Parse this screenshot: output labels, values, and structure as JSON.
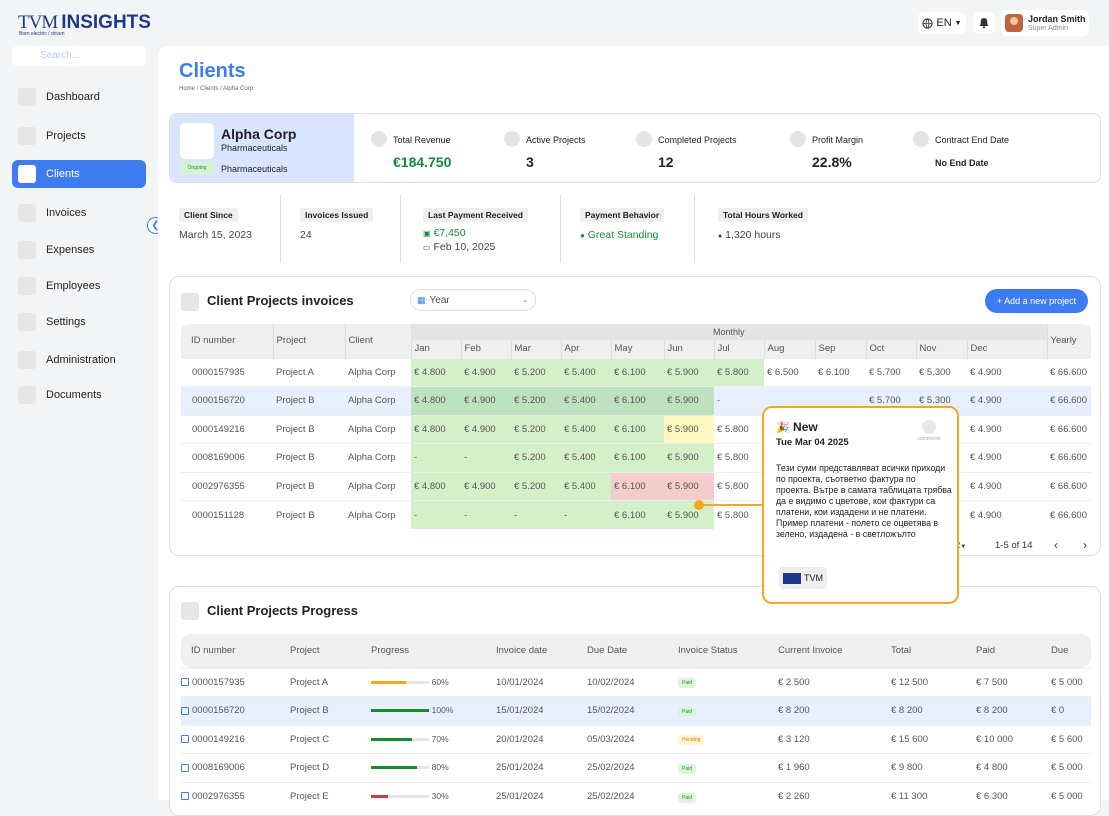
{
  "header": {
    "logo_tvm": "TVM",
    "logo_insights": "INSIGHTS",
    "logo_tagline": "Born electric / driven",
    "lang": "EN",
    "user_name": "Jordan Smith",
    "user_role": "Super Admin"
  },
  "sidebar": {
    "search_placeholder": "Search...",
    "items": [
      {
        "label": "Dashboard"
      },
      {
        "label": "Projects"
      },
      {
        "label": "Clients"
      },
      {
        "label": "Invoices"
      },
      {
        "label": "Expenses"
      },
      {
        "label": "Employees"
      },
      {
        "label": "Settings"
      },
      {
        "label": "Administration"
      },
      {
        "label": "Documents"
      }
    ],
    "active_index": 2
  },
  "page": {
    "title": "Clients",
    "breadcrumb": "Home / Clients / Alpha Corp"
  },
  "client": {
    "name": "Alpha Corp",
    "industry": "Pharmaceuticals",
    "industry2": "Pharmaceuticals",
    "status": "Ongoing",
    "stats": [
      {
        "label": "Total Revenue",
        "value": "€184.750"
      },
      {
        "label": "Active Projects",
        "value": "3"
      },
      {
        "label": "Completed Projects",
        "value": "12"
      },
      {
        "label": "Profit Margin",
        "value": "22.8%"
      },
      {
        "label": "Contract End Date",
        "value": "No End Date"
      }
    ]
  },
  "info": {
    "since_label": "Client Since",
    "since": "March 15, 2023",
    "invoices_label": "Invoices Issued",
    "invoices": "24",
    "last_label": "Last Payment Received",
    "last_amount": "€7,450",
    "last_date": "Feb 10, 2025",
    "behavior_label": "Payment Behavior",
    "behavior": "Great Standing",
    "hours_label": "Total Hours Worked",
    "hours": "1,320 hours"
  },
  "invoices_table": {
    "title": "Client Projects invoices",
    "year_placeholder": "Year",
    "add_button": "+ Add a new project",
    "col_id": "ID number",
    "col_project": "Project",
    "col_client": "Client",
    "col_monthly": "Monthly",
    "col_yearly": "Yearly",
    "months": [
      "Jan",
      "Feb",
      "Mar",
      "Apr",
      "May",
      "Jun",
      "Jul",
      "Aug",
      "Sep",
      "Oct",
      "Nov",
      "Dec"
    ],
    "rows": [
      {
        "id": "0000157935",
        "project": "Project A",
        "client": "Alpha Corp",
        "m": [
          "€ 4.800",
          "€ 4.900",
          "€ 5.200",
          "€ 5.400",
          "€ 6.100",
          "€ 5.900",
          "€ 5.800",
          "€ 6.500",
          "€ 6.100",
          "€ 5.700",
          "€ 5.300",
          "€ 4.900"
        ],
        "yearly": "€ 66.600"
      },
      {
        "id": "0000156720",
        "project": "Project B",
        "client": "Alpha Corp",
        "m": [
          "€ 4.800",
          "€ 4.900",
          "€ 5.200",
          "€ 5.400",
          "€ 6.100",
          "€ 5.900",
          "-",
          "",
          "",
          "€ 5.700",
          "€ 5.300",
          "€ 4.900"
        ],
        "yearly": "€ 66.600"
      },
      {
        "id": "0000149216",
        "project": "Project B",
        "client": "Alpha Corp",
        "m": [
          "€ 4.800",
          "€ 4.900",
          "€ 5.200",
          "€ 5.400",
          "€ 6.100",
          "€ 5.900",
          "€ 5.800",
          "",
          "",
          "",
          "",
          "€ 4.900"
        ],
        "yearly": "€ 66.600"
      },
      {
        "id": "0008169006",
        "project": "Project B",
        "client": "Alpha Corp",
        "m": [
          "-",
          "-",
          "€ 5.200",
          "€ 5.400",
          "€ 6.100",
          "€ 5.900",
          "€ 5.800",
          "",
          "",
          "",
          "",
          "€ 4.900"
        ],
        "yearly": "€ 66.600"
      },
      {
        "id": "0002976355",
        "project": "Project B",
        "client": "Alpha Corp",
        "m": [
          "€ 4.800",
          "€ 4.900",
          "€ 5.200",
          "€ 5.400",
          "€ 6.100",
          "€ 5.900",
          "€ 5.800",
          "",
          "",
          "",
          "",
          "€ 4.900"
        ],
        "yearly": "€ 66.600"
      },
      {
        "id": "0000151128",
        "project": "Project B",
        "client": "Alpha Corp",
        "m": [
          "-",
          "-",
          "-",
          "-",
          "€ 6.100",
          "€ 5.900",
          "€ 5.800",
          "",
          "",
          "",
          "",
          "€ 4.900"
        ],
        "yearly": "€ 66.600"
      }
    ],
    "page_size": "2",
    "range": "1-5 of 14"
  },
  "popup": {
    "title": "New",
    "date": "Tue Mar 04 2025",
    "comments": "comments",
    "body": "Тези суми представляват всички приходи по проекта, съответно фактура по проекта. Вътре в самата таблицата трябва да е видимо с цветове, кои фактури са платени, кои издадени и не платени. Пример платени - полето се оцветява в зелено, издадена - в светложълто",
    "button": "TVM"
  },
  "progress_table": {
    "title": "Client Projects Progress",
    "cols": [
      "ID number",
      "Project",
      "Progress",
      "Invoice date",
      "Due Date",
      "Invoice Status",
      "Current Invoice",
      "Total",
      "Paid",
      "Due"
    ],
    "rows": [
      {
        "id": "0000157935",
        "project": "Project A",
        "pct": "60%",
        "pv": 0.6,
        "color": "#f5a623",
        "inv": "10/01/2024",
        "due_date": "10/02/2024",
        "status": "Paid",
        "current": "€ 2 500",
        "total": "€ 12 500",
        "paid": "€ 7 500",
        "due": "€ 5 000"
      },
      {
        "id": "0000156720",
        "project": "Project B",
        "pct": "100%",
        "pv": 1.0,
        "color": "#1a8a2a",
        "inv": "15/01/2024",
        "due_date": "15/02/2024",
        "status": "Paid",
        "current": "€ 8 200",
        "total": "€ 8 200",
        "paid": "€ 8 200",
        "due": "€ 0"
      },
      {
        "id": "0000149216",
        "project": "Project C",
        "pct": "70%",
        "pv": 0.7,
        "color": "#1a8a2a",
        "inv": "20/01/2024",
        "due_date": "05/03/2024",
        "status": "Pending",
        "current": "€ 3 120",
        "total": "€ 15 600",
        "paid": "€ 10 000",
        "due": "€ 5 600"
      },
      {
        "id": "0008169006",
        "project": "Project D",
        "pct": "80%",
        "pv": 0.8,
        "color": "#1a8a2a",
        "inv": "25/01/2024",
        "due_date": "25/02/2024",
        "status": "Paid",
        "current": "€ 1 960",
        "total": "€ 9 800",
        "paid": "€ 4 800",
        "due": "€ 5 000"
      },
      {
        "id": "0002976355",
        "project": "Project E",
        "pct": "30%",
        "pv": 0.3,
        "color": "#d8383a",
        "inv": "25/01/2024",
        "due_date": "25/02/2024",
        "status": "Paid",
        "current": "€ 2 260",
        "total": "€ 11 300",
        "paid": "€ 6 300",
        "due": "€ 5 000"
      }
    ]
  }
}
